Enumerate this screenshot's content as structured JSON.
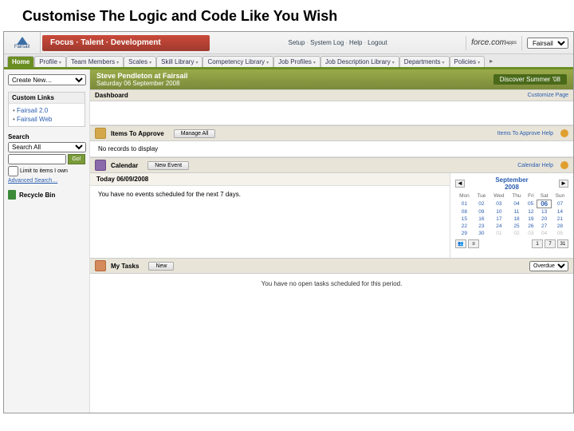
{
  "slide": {
    "title": "Customise The Logic and Code Like You Wish"
  },
  "logo": {
    "name": "Fairsail"
  },
  "brand": "Focus · Talent · Development",
  "topnav": {
    "setup": "Setup",
    "syslog": "System Log",
    "help": "Help",
    "logout": "Logout"
  },
  "platform": {
    "name": "force.com",
    "badge": "apps"
  },
  "app_selector": "Fairsail",
  "tabs": [
    "Home",
    "Profile",
    "Team Members",
    "Scales",
    "Skill Library",
    "Competency Library",
    "Job Profiles",
    "Job Description Library",
    "Departments",
    "Policies"
  ],
  "create_new": "Create New…",
  "custom_links": {
    "title": "Custom Links",
    "items": [
      "Fairsail 2.0",
      "Fairsail Web"
    ]
  },
  "search": {
    "title": "Search",
    "scope": "Search All",
    "go": "Go!",
    "limit": "Limit to items I own",
    "advanced": "Advanced Search…",
    "placeholder": ""
  },
  "recycle": "Recycle Bin",
  "user": {
    "line": "Steve Pendleton at Fairsail",
    "date": "Saturday 06 September 2008",
    "discover": "Discover Summer '08"
  },
  "dashboard": {
    "title": "Dashboard",
    "customize": "Customize Page"
  },
  "approve": {
    "title": "Items To Approve",
    "manage": "Manage All",
    "help": "Items To Approve Help",
    "empty": "No records to display"
  },
  "calendar": {
    "title": "Calendar",
    "new": "New Event",
    "help": "Calendar Help",
    "today": "Today 06/09/2008",
    "msg": "You have no events scheduled for the next 7 days.",
    "month": "September",
    "year": "2008",
    "dow": [
      "Mon",
      "Tue",
      "Wed",
      "Thu",
      "Fri",
      "Sat",
      "Sun"
    ],
    "weeks": [
      [
        "01",
        "02",
        "03",
        "04",
        "05",
        "06",
        "07"
      ],
      [
        "08",
        "09",
        "10",
        "11",
        "12",
        "13",
        "14"
      ],
      [
        "15",
        "16",
        "17",
        "18",
        "19",
        "20",
        "21"
      ],
      [
        "22",
        "23",
        "24",
        "25",
        "26",
        "27",
        "28"
      ],
      [
        "29",
        "30",
        "01",
        "02",
        "03",
        "04",
        "05"
      ]
    ],
    "today_cell": "06",
    "views": {
      "a": "👥",
      "b": "≡",
      "c": "1",
      "d": "7",
      "e": "31"
    }
  },
  "tasks": {
    "title": "My Tasks",
    "new": "New",
    "filter": "Overdue",
    "msg": "You have no open tasks scheduled for this period."
  }
}
